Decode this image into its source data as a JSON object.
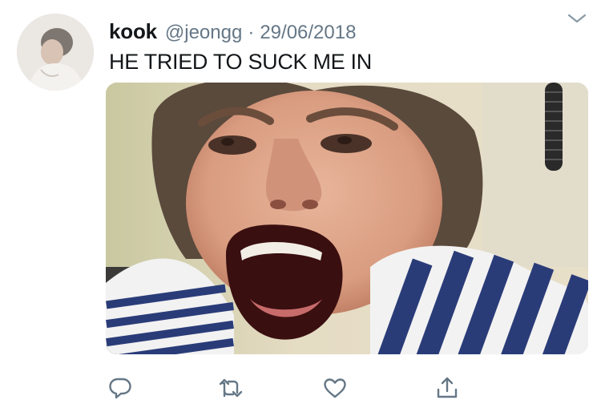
{
  "tweet": {
    "author_name": "kook",
    "author_handle": "@jeongg",
    "separator": "·",
    "date": "29/06/2018",
    "text": "HE TRIED TO SUCK ME IN"
  },
  "icons": {
    "avatar": "profile-photo",
    "menu": "chevron-down-icon",
    "reply": "reply-icon",
    "retweet": "retweet-icon",
    "like": "heart-icon",
    "share": "share-icon"
  },
  "colors": {
    "primary_text": "#14171a",
    "secondary_text": "#657786",
    "icon": "#657786"
  }
}
